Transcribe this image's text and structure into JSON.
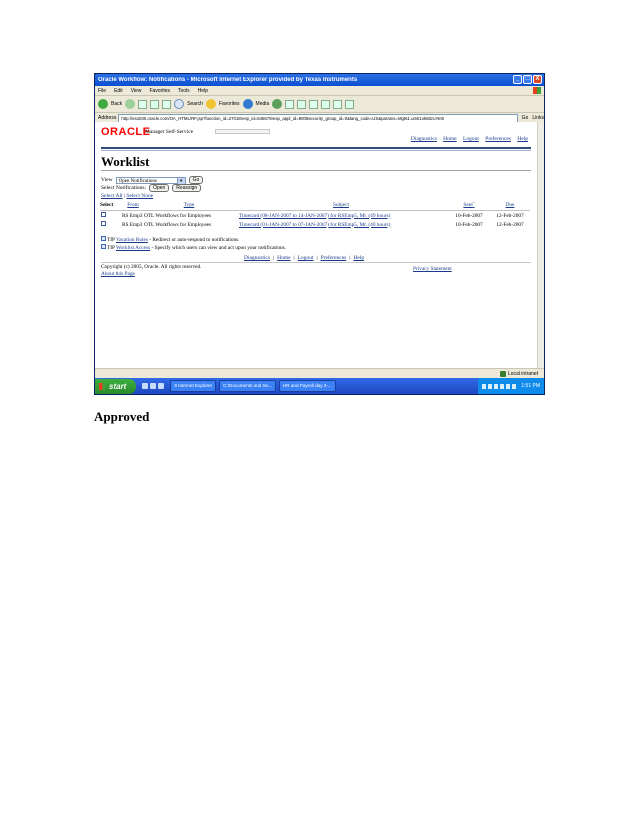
{
  "window": {
    "title": "Oracle Workflow: Notifications - Microsoft Internet Explorer provided by Texas Instruments",
    "controls": [
      "_",
      "□",
      "X"
    ]
  },
  "menu": [
    "File",
    "Edit",
    "View",
    "Favorites",
    "Tools",
    "Help"
  ],
  "toolbar": {
    "back": "Back",
    "search": "Search",
    "favorites": "Favorites",
    "media": "Media"
  },
  "address": {
    "label": "Address",
    "url": "http://eso030.oracle.com/OA_HTML/RF.jsp?function_id=27018resp_id=546678resp_appl_id=8006security_group_id=0&lang_code=US&params=Mgt61.u04I1vk58zuYeI8",
    "go": "Go",
    "links": "Links"
  },
  "app": {
    "logo": "ORACLE",
    "brand": "Manager Self-Service",
    "global_links": [
      "Diagnostics",
      "Home",
      "Logout",
      "Preferences",
      "Help"
    ]
  },
  "worklist": {
    "title": "Worklist",
    "view_label": "View",
    "view_value": "Open Notifications",
    "go": "Go",
    "select_notifications_label": "Select Notifications:",
    "open_button": "Open",
    "reassign_button": "Reassign",
    "select_all": "Select All",
    "select_none": "Select None",
    "separator": "|",
    "columns": {
      "select": "Select",
      "from": "From",
      "type": "Type",
      "subject": "Subject",
      "sent": "Sent",
      "due": "Due"
    },
    "rows": [
      {
        "from": "RS Emp3",
        "type": "OTL Workflows for Employees",
        "subject": "Timecard (08-JAN-2007 to 14-JAN-2007) for RSEmp5, Mr. (49 hours)",
        "sent": "10-Feb-2007",
        "due": "12-Feb-2007"
      },
      {
        "from": "RS Emp3",
        "type": "OTL Workflows for Employees",
        "subject": "Timecard (01-JAN-2007 to 07-JAN-2007) for RSEmp5, Mr. (40 hours)",
        "sent": "10-Feb-2007",
        "due": "12-Feb-2007"
      }
    ],
    "tips": [
      {
        "label": "TIP",
        "link": "Vacation Rules",
        "text": " - Redirect or auto-respond to notifications."
      },
      {
        "label": "TIP",
        "link": "Worklist Access",
        "text": " - Specify which users can view and act upon your notifications."
      }
    ]
  },
  "footer": {
    "links": [
      "Diagnostics",
      "Home",
      "Logout",
      "Preferences",
      "Help"
    ],
    "copyright": "Copyright (c) 2005, Oracle. All rights reserved.",
    "about": "About this Page",
    "privacy": "Privacy Statement"
  },
  "statusbar": {
    "zone": "Local intranet"
  },
  "taskbar": {
    "start": "start",
    "tasks": [
      "9 Internet Explorer",
      "C:\\Documents and Se...",
      "HR and Payroll day 3-..."
    ],
    "clock": "1:51 PM"
  },
  "caption": "Approved"
}
